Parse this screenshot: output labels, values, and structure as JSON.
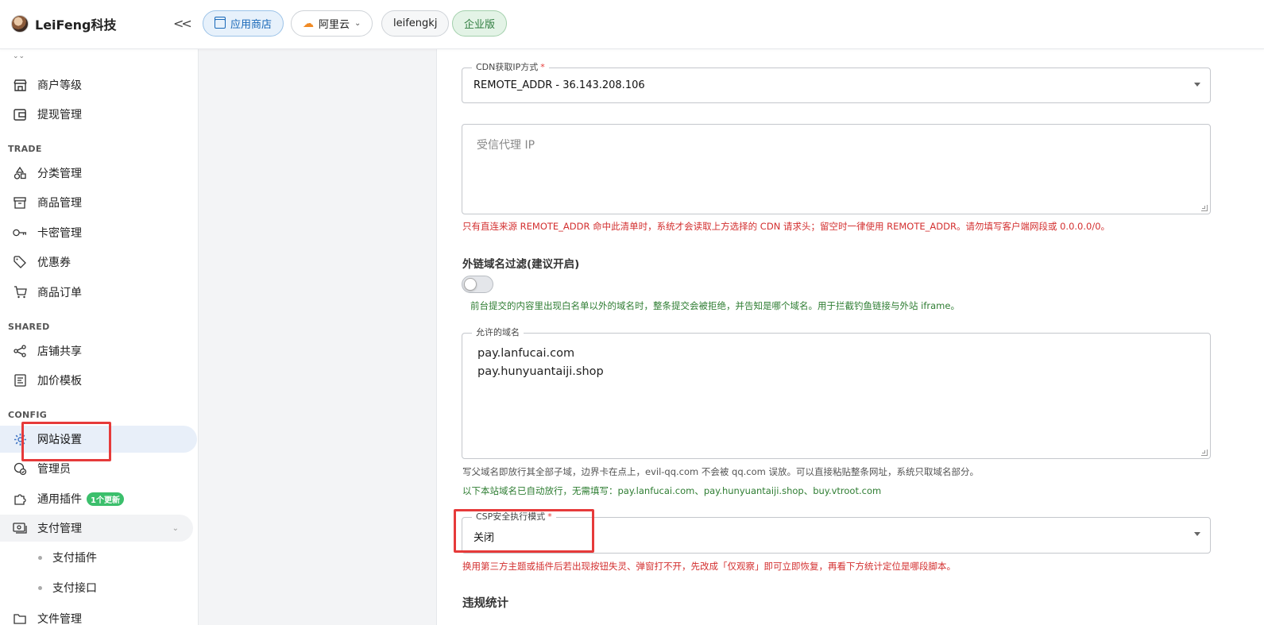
{
  "header": {
    "brand": "LeiFeng科技",
    "collapse_icon": "double-chevron-left-icon",
    "store_label": "应用商店",
    "cloud_label": "阿里云",
    "user_label": "leifengkj",
    "edition_label": "企业版"
  },
  "sidebar": {
    "top_items": [
      {
        "label": "商户等级",
        "icon": "store-icon"
      },
      {
        "label": "提现管理",
        "icon": "wallet-icon"
      }
    ],
    "sections": {
      "trade": "TRADE",
      "shared": "SHARED",
      "config": "CONFIG"
    },
    "trade_items": [
      {
        "label": "分类管理",
        "icon": "category-icon"
      },
      {
        "label": "商品管理",
        "icon": "archive-icon"
      },
      {
        "label": "卡密管理",
        "icon": "key-icon"
      },
      {
        "label": "优惠券",
        "icon": "tag-icon"
      },
      {
        "label": "商品订单",
        "icon": "cart-icon"
      }
    ],
    "shared_items": [
      {
        "label": "店铺共享",
        "icon": "share-icon"
      },
      {
        "label": "加价模板",
        "icon": "template-icon"
      }
    ],
    "config_items": [
      {
        "label": "网站设置",
        "icon": "gear-icon"
      },
      {
        "label": "管理员",
        "icon": "admin-icon"
      },
      {
        "label": "通用插件",
        "icon": "puzzle-icon",
        "badge": "1个更新"
      },
      {
        "label": "支付管理",
        "icon": "payment-icon"
      }
    ],
    "pay_sub_items": [
      {
        "label": "支付插件"
      },
      {
        "label": "支付接口"
      }
    ],
    "partial_item": "文件管理"
  },
  "form": {
    "cdn_legend": "CDN获取IP方式",
    "cdn_value": "REMOTE_ADDR - 36.143.208.106",
    "trusted_placeholder": "受信代理 IP",
    "trusted_hint": "只有直连来源 REMOTE_ADDR 命中此清单时，系统才会读取上方选择的 CDN 请求头；留空时一律使用 REMOTE_ADDR。请勿填写客户端网段或 0.0.0.0/0。",
    "filter_label": "外链域名过滤(建议开启)",
    "filter_enabled": false,
    "filter_hint": "前台提交的内容里出现白名单以外的域名时，整条提交会被拒绝，并告知是哪个域名。用于拦截钓鱼链接与外站 iframe。",
    "allowed_legend": "允许的域名",
    "allowed_domains": [
      "pay.lanfucai.com",
      "pay.hunyuantaiji.shop"
    ],
    "allowed_hint_1": "写父域名即放行其全部子域，边界卡在点上，evil-qq.com 不会被 qq.com 误放。可以直接粘贴整条网址，系统只取域名部分。",
    "allowed_hint_2": "以下本站域名已自动放行，无需填写：pay.lanfucai.com、pay.hunyuantaiji.shop、buy.vtroot.com",
    "csp_legend": "CSP安全执行模式",
    "csp_value": "关闭",
    "csp_hint": "换用第三方主题或插件后若出现按钮失灵、弹窗打不开，先改成「仅观察」即可立即恢复，再看下方统计定位是哪段脚本。",
    "violation_title": "违规统计"
  },
  "colors": {
    "annotation_red": "#e63a3a",
    "hint_red": "#d32f2f",
    "hint_green": "#2e7d32",
    "active_bg": "#e8eff9"
  }
}
